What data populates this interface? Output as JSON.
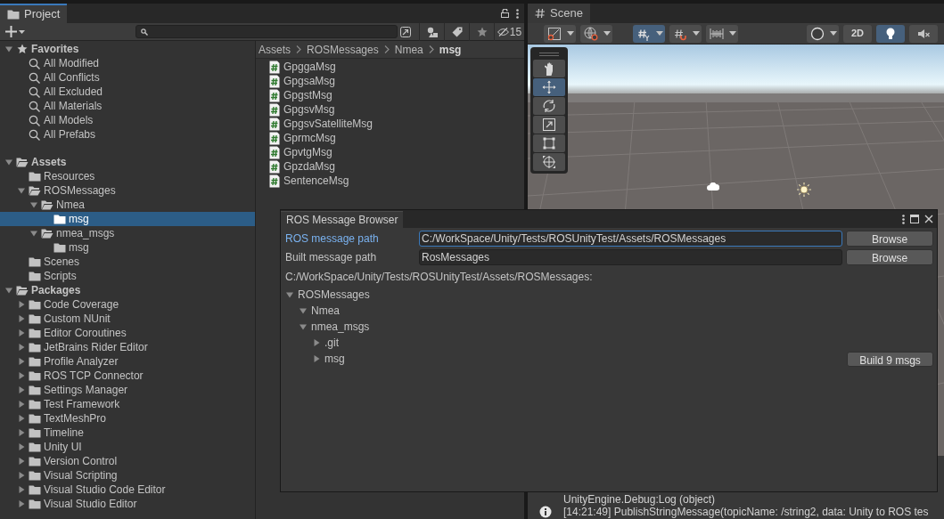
{
  "project_panel": {
    "tab": {
      "label": "Project",
      "selected": true
    },
    "hidden_packages_count": "15",
    "tree": [
      {
        "label": "Favorites",
        "kind": "favorites",
        "expanded": true,
        "selected": false,
        "children": [
          {
            "label": "All Modified",
            "kind": "search",
            "selected": false
          },
          {
            "label": "All Conflicts",
            "kind": "search",
            "selected": false
          },
          {
            "label": "All Excluded",
            "kind": "search",
            "selected": false
          },
          {
            "label": "All Materials",
            "kind": "search",
            "selected": false
          },
          {
            "label": "All Models",
            "kind": "search",
            "selected": false
          },
          {
            "label": "All Prefabs",
            "kind": "search",
            "selected": false
          }
        ]
      },
      {
        "label": "Assets",
        "kind": "root",
        "expanded": true,
        "selected": false,
        "children": [
          {
            "label": "Resources",
            "kind": "folder",
            "selected": false
          },
          {
            "label": "ROSMessages",
            "kind": "folder",
            "expanded": true,
            "selected": false,
            "children": [
              {
                "label": "Nmea",
                "kind": "folder",
                "expanded": true,
                "selected": false,
                "children": [
                  {
                    "label": "msg",
                    "kind": "folder",
                    "selected": true
                  }
                ]
              },
              {
                "label": "nmea_msgs",
                "kind": "folder",
                "expanded": true,
                "selected": false,
                "children": [
                  {
                    "label": "msg",
                    "kind": "folder",
                    "selected": false
                  }
                ]
              }
            ]
          },
          {
            "label": "Scenes",
            "kind": "folder",
            "selected": false
          },
          {
            "label": "Scripts",
            "kind": "folder",
            "selected": false
          }
        ]
      },
      {
        "label": "Packages",
        "kind": "root",
        "expanded": true,
        "selected": false,
        "children": [
          {
            "label": "Code Coverage",
            "kind": "folder",
            "expanded": false,
            "selected": false
          },
          {
            "label": "Custom NUnit",
            "kind": "folder",
            "expanded": false,
            "selected": false
          },
          {
            "label": "Editor Coroutines",
            "kind": "folder",
            "expanded": false,
            "selected": false
          },
          {
            "label": "JetBrains Rider Editor",
            "kind": "folder",
            "expanded": false,
            "selected": false
          },
          {
            "label": "Profile Analyzer",
            "kind": "folder",
            "expanded": false,
            "selected": false
          },
          {
            "label": "ROS TCP Connector",
            "kind": "folder",
            "expanded": false,
            "selected": false
          },
          {
            "label": "Settings Manager",
            "kind": "folder",
            "expanded": false,
            "selected": false
          },
          {
            "label": "Test Framework",
            "kind": "folder",
            "expanded": false,
            "selected": false
          },
          {
            "label": "TextMeshPro",
            "kind": "folder",
            "expanded": false,
            "selected": false
          },
          {
            "label": "Timeline",
            "kind": "folder",
            "expanded": false,
            "selected": false
          },
          {
            "label": "Unity UI",
            "kind": "folder",
            "expanded": false,
            "selected": false
          },
          {
            "label": "Version Control",
            "kind": "folder",
            "expanded": false,
            "selected": false
          },
          {
            "label": "Visual Scripting",
            "kind": "folder",
            "expanded": false,
            "selected": false
          },
          {
            "label": "Visual Studio Code Editor",
            "kind": "folder",
            "expanded": false,
            "selected": false
          },
          {
            "label": "Visual Studio Editor",
            "kind": "folder",
            "expanded": false,
            "selected": false
          }
        ]
      }
    ],
    "breadcrumb": [
      {
        "label": "Assets",
        "current": false
      },
      {
        "label": "ROSMessages",
        "current": false
      },
      {
        "label": "Nmea",
        "current": false
      },
      {
        "label": "msg",
        "current": true
      }
    ],
    "files": [
      {
        "label": "GpggaMsg",
        "kind": "script"
      },
      {
        "label": "GpgsaMsg",
        "kind": "script"
      },
      {
        "label": "GpgstMsg",
        "kind": "script"
      },
      {
        "label": "GpgsvMsg",
        "kind": "script"
      },
      {
        "label": "GpgsvSatelliteMsg",
        "kind": "script"
      },
      {
        "label": "GprmcMsg",
        "kind": "script"
      },
      {
        "label": "GpvtgMsg",
        "kind": "script"
      },
      {
        "label": "GpzdaMsg",
        "kind": "script"
      },
      {
        "label": "SentenceMsg",
        "kind": "script"
      }
    ]
  },
  "scene_panel": {
    "tab": {
      "label": "Scene",
      "selected": false
    },
    "toolbar": [
      {
        "kind": "gizmo-tool",
        "on": false,
        "dropdown": true
      },
      {
        "kind": "global",
        "on": false,
        "dropdown": true
      },
      {
        "kind": "grid",
        "on": true,
        "dropdown": true
      },
      {
        "kind": "snap",
        "on": false,
        "dropdown": true
      },
      {
        "kind": "increment",
        "on": false,
        "dropdown": true
      },
      {
        "kind": "shading",
        "on": false,
        "dropdown": true
      },
      {
        "kind": "mode-2d",
        "label": "2D",
        "on": false,
        "dropdown": false
      },
      {
        "kind": "lighting",
        "on": true,
        "dropdown": false
      },
      {
        "kind": "audio",
        "on": false,
        "dropdown": false
      }
    ],
    "tools": [
      {
        "kind": "hand",
        "selected": false
      },
      {
        "kind": "move",
        "selected": true
      },
      {
        "kind": "rotate",
        "selected": false
      },
      {
        "kind": "scale",
        "selected": false
      },
      {
        "kind": "rect",
        "selected": false
      },
      {
        "kind": "transform",
        "selected": false
      }
    ]
  },
  "ros_message_browser": {
    "tab": "ROS Message Browser",
    "fields": [
      {
        "label": "ROS message path",
        "value": "C:/WorkSpace/Unity/Tests/ROSUnityTest/Assets/ROSMessages",
        "focused": true,
        "button": "Browse"
      },
      {
        "label": "Built message path",
        "value": "RosMessages",
        "focused": false,
        "button": "Browse"
      }
    ],
    "source_path": "C:/WorkSpace/Unity/Tests/ROSUnityTest/Assets/ROSMessages:",
    "tree": [
      {
        "label": "ROSMessages",
        "expanded": true,
        "children": [
          {
            "label": "Nmea",
            "expanded": true
          },
          {
            "label": "nmea_msgs",
            "expanded": true,
            "children": [
              {
                "label": ".git",
                "expanded": false
              },
              {
                "label": "msg",
                "expanded": false
              }
            ]
          }
        ]
      }
    ],
    "build_button": "Build 9 msgs"
  },
  "console": {
    "lines": [
      {
        "kind": "trace",
        "text": "UnityEngine.Debug:Log (object)"
      },
      {
        "kind": "info",
        "text": "[14:21:49] PublishStringMessage(topicName: /string2, data: Unity to ROS tes"
      }
    ]
  }
}
